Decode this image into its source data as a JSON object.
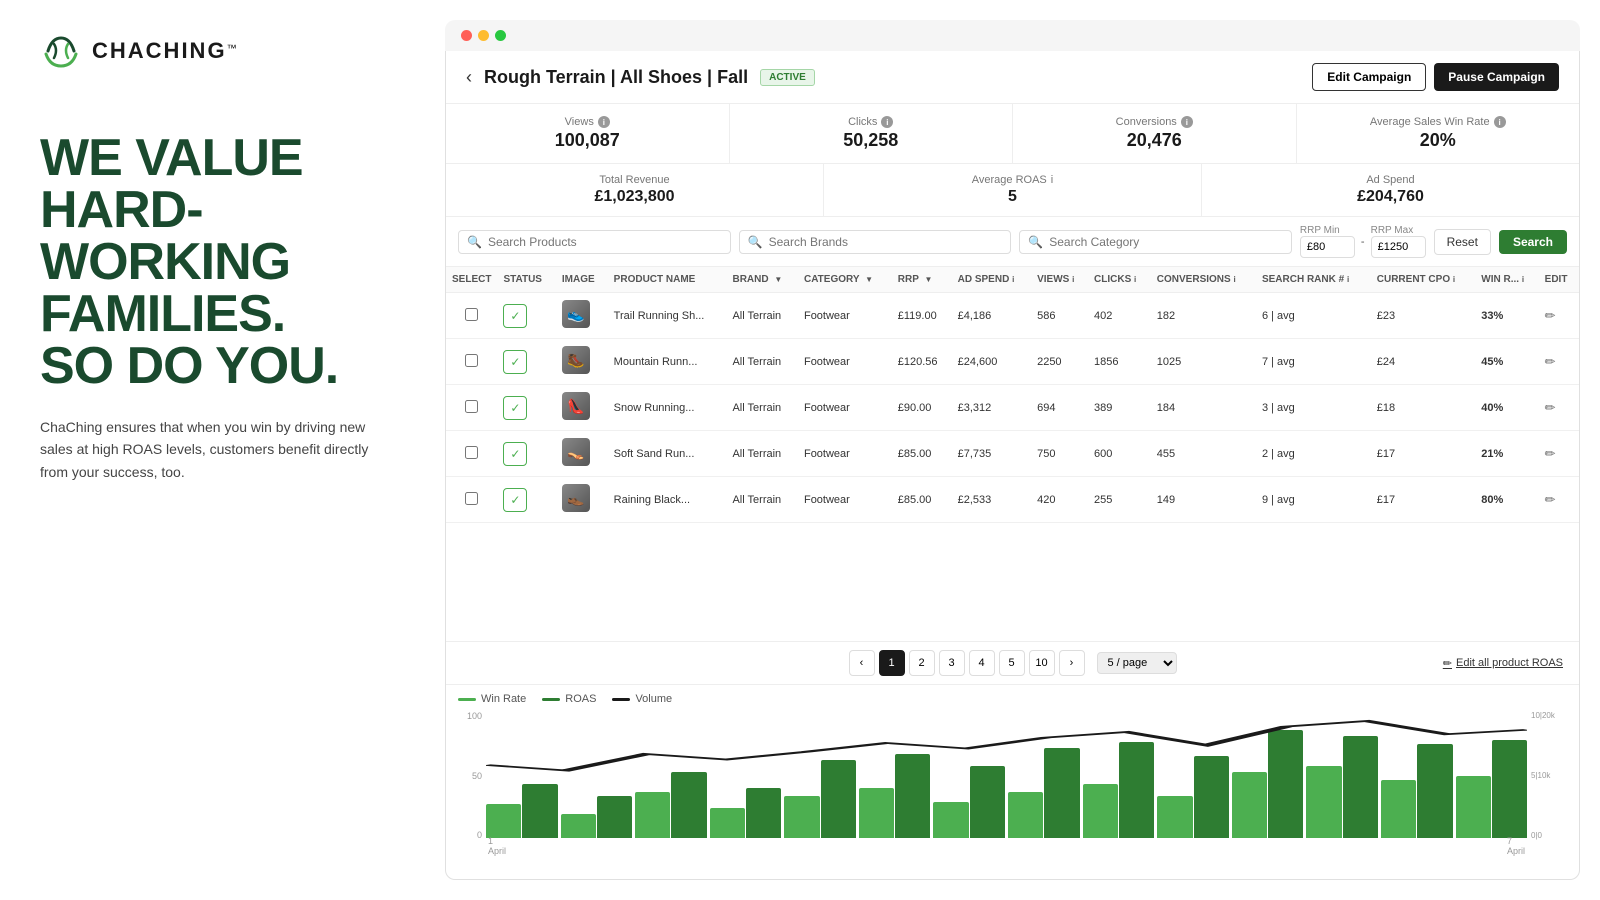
{
  "brand": {
    "name": "CHACHING",
    "tm": "™"
  },
  "hero": {
    "line1": "WE VALUE",
    "line2": "HARD-",
    "line3": "WORKING",
    "line4": "FAMILIES.",
    "line5": "SO DO YOU.",
    "subtext": "ChaChing ensures that when you win by driving new sales at high ROAS levels, customers benefit directly from your success, too."
  },
  "campaign": {
    "title": "Rough Terrain | All Shoes | Fall",
    "status": "ACTIVE",
    "edit_btn": "Edit Campaign",
    "pause_btn": "Pause Campaign"
  },
  "stats": [
    {
      "label": "Views",
      "value": "100,087"
    },
    {
      "label": "Clicks",
      "value": "50,258"
    },
    {
      "label": "Conversions",
      "value": "20,476"
    },
    {
      "label": "Average Sales Win Rate",
      "value": "20%"
    }
  ],
  "revenue": [
    {
      "label": "Total Revenue",
      "value": "£1,023,800"
    },
    {
      "label": "Average ROAS",
      "value": "5"
    },
    {
      "label": "Ad Spend",
      "value": "£204,760"
    }
  ],
  "search": {
    "products_placeholder": "Search Products",
    "brands_placeholder": "Search Brands",
    "category_placeholder": "Search Category",
    "rrp_min_label": "RRP Min",
    "rrp_min_value": "£80",
    "rrp_max_label": "RRP Max",
    "rrp_max_value": "£1250",
    "reset_label": "Reset",
    "search_label": "Search"
  },
  "table": {
    "columns": [
      "SELECT",
      "STATUS",
      "IMAGE",
      "PRODUCT NAME",
      "BRAND",
      "CATEGORY",
      "RRP",
      "AD SPEND",
      "VIEWS",
      "CLICKS",
      "CONVERSIONS",
      "SEARCH RANK #",
      "CURRENT CPO",
      "WIN R...",
      "EDIT"
    ],
    "rows": [
      {
        "product": "Trail Running Sh...",
        "brand": "All Terrain",
        "category": "Footwear",
        "rrp": "£119.00",
        "ad_spend": "£4,186",
        "views": "586",
        "clicks": "402",
        "conversions": "182",
        "rank": "6 | avg",
        "cpo": "£23",
        "win_rate": "33%",
        "status": true
      },
      {
        "product": "Mountain Runn...",
        "brand": "All Terrain",
        "category": "Footwear",
        "rrp": "£120.56",
        "ad_spend": "£24,600",
        "views": "2250",
        "clicks": "1856",
        "conversions": "1025",
        "rank": "7 | avg",
        "cpo": "£24",
        "win_rate": "45%",
        "status": true
      },
      {
        "product": "Snow Running...",
        "brand": "All Terrain",
        "category": "Footwear",
        "rrp": "£90.00",
        "ad_spend": "£3,312",
        "views": "694",
        "clicks": "389",
        "conversions": "184",
        "rank": "3 | avg",
        "cpo": "£18",
        "win_rate": "40%",
        "status": true
      },
      {
        "product": "Soft Sand Run...",
        "brand": "All Terrain",
        "category": "Footwear",
        "rrp": "£85.00",
        "ad_spend": "£7,735",
        "views": "750",
        "clicks": "600",
        "conversions": "455",
        "rank": "2 | avg",
        "cpo": "£17",
        "win_rate": "21%",
        "status": true
      },
      {
        "product": "Raining Black...",
        "brand": "All Terrain",
        "category": "Footwear",
        "rrp": "£85.00",
        "ad_spend": "£2,533",
        "views": "420",
        "clicks": "255",
        "conversions": "149",
        "rank": "9 | avg",
        "cpo": "£17",
        "win_rate": "80%",
        "status": true
      }
    ]
  },
  "pagination": {
    "pages": [
      "1",
      "2",
      "3",
      "4",
      "5"
    ],
    "current": "1",
    "per_page": "5 / page",
    "next": "›",
    "prev": "‹",
    "edit_all": "Edit all product ROAS"
  },
  "chart": {
    "legend": {
      "win_rate_label": "Win Rate",
      "roas_label": "ROAS",
      "volume_label": "Volume"
    },
    "y_left_labels": [
      "100",
      "50",
      "0"
    ],
    "y_right_labels": [
      "10 | 20k",
      "5 | 10k",
      "0 | 0"
    ],
    "x_labels_start": "1\nApril",
    "x_labels_end": "7\nApril",
    "bars": [
      {
        "win": 28,
        "roas": 45,
        "volume": 60
      },
      {
        "win": 20,
        "roas": 35,
        "volume": 55
      },
      {
        "win": 38,
        "roas": 55,
        "volume": 70
      },
      {
        "win": 25,
        "roas": 42,
        "volume": 65
      },
      {
        "win": 35,
        "roas": 65,
        "volume": 72
      },
      {
        "win": 42,
        "roas": 70,
        "volume": 80
      },
      {
        "win": 30,
        "roas": 60,
        "volume": 75
      },
      {
        "win": 38,
        "roas": 75,
        "volume": 85
      },
      {
        "win": 45,
        "roas": 80,
        "volume": 90
      },
      {
        "win": 35,
        "roas": 68,
        "volume": 78
      },
      {
        "win": 55,
        "roas": 90,
        "volume": 95
      },
      {
        "win": 60,
        "roas": 85,
        "volume": 100
      },
      {
        "win": 48,
        "roas": 78,
        "volume": 88
      },
      {
        "win": 52,
        "roas": 82,
        "volume": 92
      }
    ]
  }
}
